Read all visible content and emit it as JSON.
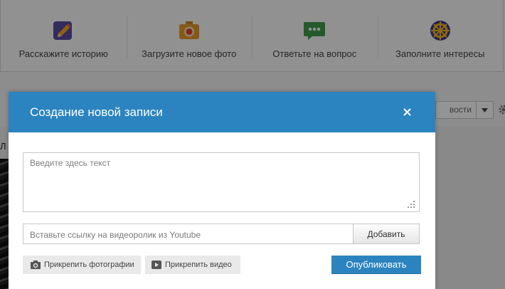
{
  "actions": [
    {
      "label": "Расскажите историю",
      "icon": "pencil-icon"
    },
    {
      "label": "Загрузите новое фото",
      "icon": "camera-icon"
    },
    {
      "label": "Ответьте на вопрос",
      "icon": "chat-bubble-icon"
    },
    {
      "label": "Заполните интересы",
      "icon": "dharma-wheel-icon"
    }
  ],
  "feed": {
    "sort_value": "вости",
    "edge_text": "Л"
  },
  "modal": {
    "title": "Создание новой записи",
    "close_symbol": "×",
    "text_placeholder": "Введите здесь текст",
    "video_placeholder": "Вставьте ссылку на видеоролик из Youtube",
    "add_label": "Добавить",
    "attach_photo_label": "Прикрепить фотографии",
    "attach_video_label": "Прикрепить видео",
    "publish_label": "Опубликовать"
  },
  "colors": {
    "primary": "#2b84c0",
    "icon_purple": "#5b4aa0",
    "icon_orange": "#e59b2a",
    "icon_green": "#3f9b4a",
    "icon_navy": "#3d3a82"
  }
}
